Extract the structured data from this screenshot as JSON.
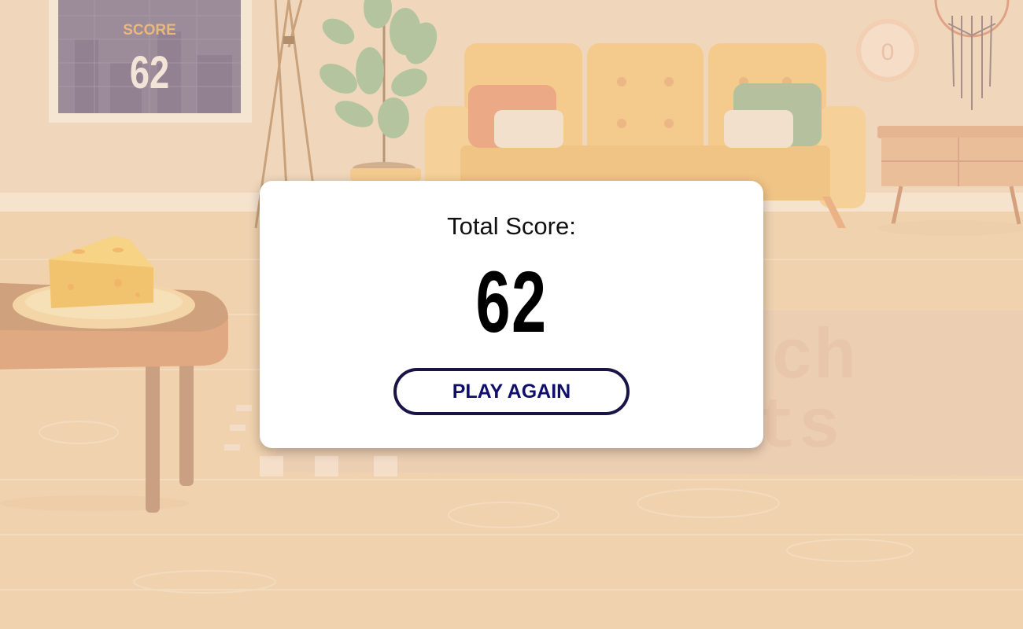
{
  "background": {
    "wall_scoreboard": {
      "label": "SCORE",
      "value": "62"
    },
    "clock": {
      "digit": "0"
    },
    "rug_text": [
      "ch",
      "ts"
    ]
  },
  "modal": {
    "title": "Total Score:",
    "score": "62",
    "play_again_label": "PLAY AGAIN"
  },
  "colors": {
    "wall": "#efd2b2",
    "floor": "#efcda4",
    "sofa": "#f3c272",
    "button_border": "#1a1446",
    "button_text": "#0f0f6b"
  }
}
